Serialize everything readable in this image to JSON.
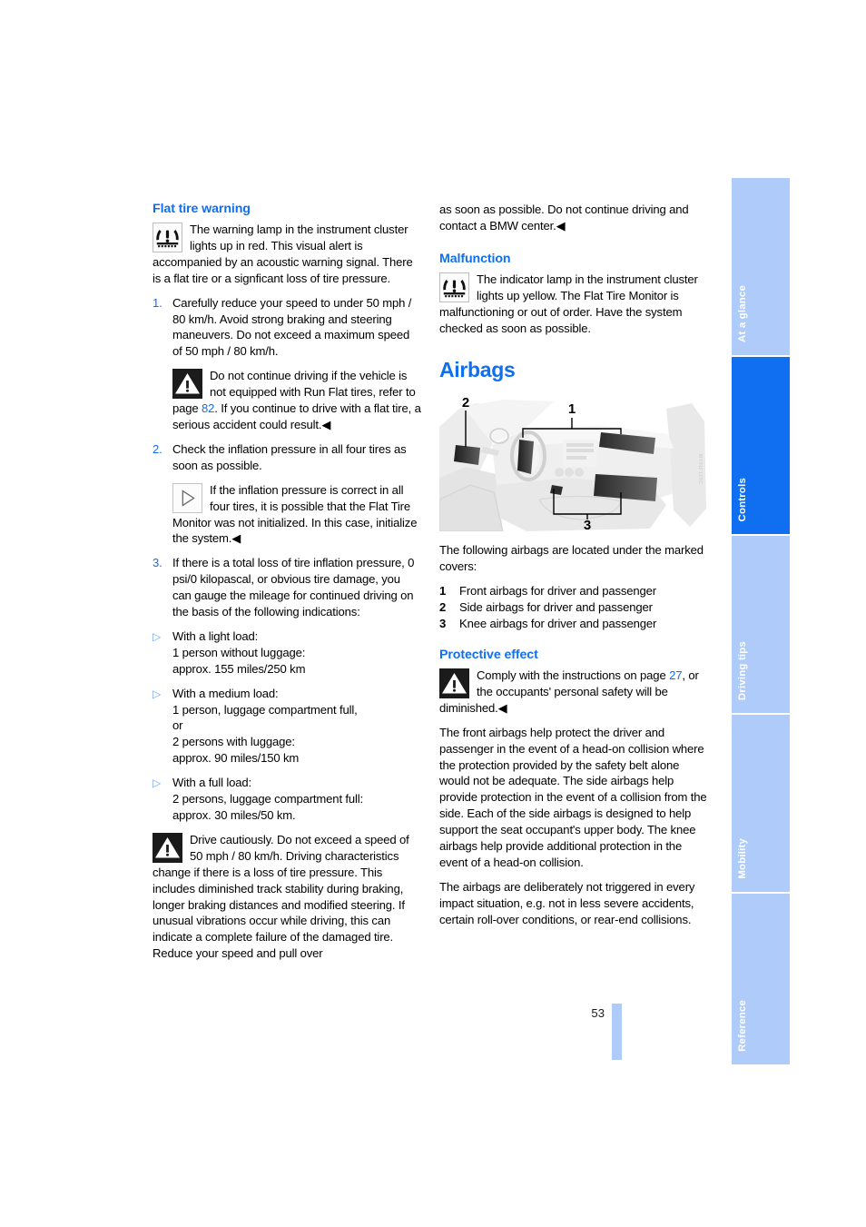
{
  "page": {
    "number": "53"
  },
  "left_column": {
    "section1": {
      "heading": "Flat tire warning",
      "icon": "tire-pressure-warning-icon",
      "note_text": "The warning lamp in the instrument cluster lights up in red. This visual alert is accompanied by an acoustic warning signal. There is a flat tire or a signficant loss of tire pressure.",
      "steps": [
        {
          "number": "1.",
          "text": "Carefully reduce your speed to under 50 mph / 80 km/h. Avoid strong braking and steering maneuvers. Do not exceed a maximum speed of 50 mph / 80 km/h."
        },
        {
          "number": "2.",
          "text": "Check the inflation pressure in all four tires as soon as possible."
        },
        {
          "number": "3.",
          "text": "If there is a total loss of tire inflation pressure, 0 psi/0 kilopascal, or obvious tire damage, you can gauge the mileage for continued driving on the basis of the following indications:"
        }
      ],
      "warning_after_step1": {
        "icon": "warning-triangle-icon",
        "text_part1": "Do not continue driving if the vehicle is not equipped with Run Flat tires, refer to page ",
        "page_link": "82",
        "text_part2": ". If you continue to drive with a flat tire, a serious accident could result.",
        "endmark": "◀"
      },
      "info_after_step2": {
        "icon": "info-arrow-icon",
        "text": "If the inflation pressure is correct in all four tires, it is possible that the Flat Tire Monitor was not initialized. In this case, initialize the system.",
        "endmark": "◀"
      },
      "load_items": [
        {
          "bullet": "▷",
          "lines": [
            "With a light load:",
            "1 person without luggage:",
            "approx. 155 miles/250 km"
          ]
        },
        {
          "bullet": "▷",
          "lines": [
            "With a medium load:",
            "1 person, luggage compartment full,",
            "or",
            "2 persons with luggage:",
            "approx. 90 miles/150 km"
          ]
        },
        {
          "bullet": "▷",
          "lines": [
            "With a full load:",
            "2 persons, luggage compartment full:",
            "approx. 30 miles/50 km."
          ]
        }
      ],
      "final_warning": {
        "icon": "warning-triangle-icon",
        "text": "Drive cautiously. Do not exceed a speed of 50 mph / 80 km/h. Driving characteristics change if there is a loss of tire pressure. This includes diminished track stability during braking, longer braking distances and modified steering. If unusual vibrations occur while driving, this can indicate a complete failure of the damaged tire. Reduce your speed and pull over"
      }
    }
  },
  "right_column": {
    "continuation": {
      "text": "as soon as possible. Do not continue driving and contact a BMW center.",
      "endmark": "◀"
    },
    "malfunction": {
      "heading": "Malfunction",
      "icon": "tire-pressure-warning-icon",
      "text": "The indicator lamp in the instrument cluster lights up yellow. The Flat Tire Monitor is malfunctioning or out of order. Have the system checked as soon as possible."
    },
    "airbags": {
      "heading": "Airbags",
      "figure": {
        "name": "airbag-locations-diagram",
        "callouts": [
          "1",
          "2",
          "3"
        ],
        "watermark": "MY01F12SC"
      },
      "intro": "The following airbags are located under the marked covers:",
      "items": [
        {
          "number": "1",
          "text": "Front airbags for driver and passenger"
        },
        {
          "number": "2",
          "text": "Side airbags for driver and passenger"
        },
        {
          "number": "3",
          "text": "Knee airbags for driver and passenger"
        }
      ]
    },
    "protective_effect": {
      "heading": "Protective effect",
      "warning": {
        "icon": "warning-triangle-icon",
        "text_part1": "Comply with the instructions on page ",
        "page_link": "27",
        "text_part2": ", or the occupants' personal safety will be diminished.",
        "endmark": "◀"
      },
      "paragraph1": "The front airbags help protect the driver and passenger in the event of a head-on collision where the protection provided by the safety belt alone would not be adequate. The side airbags help provide protection in the event of a collision from the side. Each of the side airbags is designed to help support the seat occupant's upper body. The knee airbags help provide additional protection in the event of a head-on collision.",
      "paragraph2": "The airbags are deliberately not triggered in every impact situation, e.g. not in less severe accidents, certain roll-over conditions, or rear-end collisions."
    }
  },
  "side_tabs": [
    {
      "label": "At a glance",
      "active": false
    },
    {
      "label": "Controls",
      "active": true
    },
    {
      "label": "Driving tips",
      "active": false
    },
    {
      "label": "Mobility",
      "active": false
    },
    {
      "label": "Reference",
      "active": false
    }
  ],
  "colors": {
    "accent_blue": "#0f6ff0",
    "tab_blue": "#aecbfa"
  }
}
